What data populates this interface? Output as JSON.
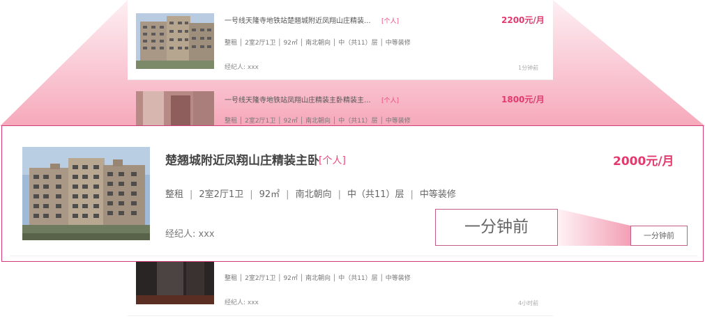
{
  "background_listings": [
    {
      "title": "一号线天隆寺地铁站楚翘城附近凤翔山庄精装...",
      "tag": "[个人]",
      "price": "2200元/月",
      "meta": "整租 │ 2室2厅1卫 │ 92㎡ │ 南北朝向 │ 中（共11）层 │ 中等装修",
      "agent": "经纪人: xxx",
      "time": "1分钟前"
    },
    {
      "title": "一号线天隆寺地铁站凤翔山庄精装主卧精装主...",
      "tag": "[个人]",
      "price": "1800元/月",
      "meta": "整租 │ 2室2厅1卫 │ 92㎡ │ 南北朝向 │ 中（共11）层 │ 中等装修"
    },
    {
      "meta": "整租 │ 2室2厅1卫 │ 92㎡ │ 南北朝向 │ 中（共11）层 │ 中等装修",
      "agent": "经纪人: xxx",
      "time": "4小时前"
    }
  ],
  "featured_listing": {
    "title": "楚翘城附近凤翔山庄精装主卧",
    "tag": "[个人]",
    "price": "2000元/月",
    "meta": [
      "整租",
      "2室2厅1卫",
      "92㎡",
      "南北朝向",
      "中（共11）层",
      "中等装修"
    ],
    "meta_separator": "|",
    "agent": "经纪人: xxx"
  },
  "callout": {
    "zoomed_text": "一分钟前",
    "original_text": "一分钟前"
  },
  "colors": {
    "accent": "#e23a6c",
    "tag": "#e94a7c",
    "frame": "#d23a77"
  }
}
